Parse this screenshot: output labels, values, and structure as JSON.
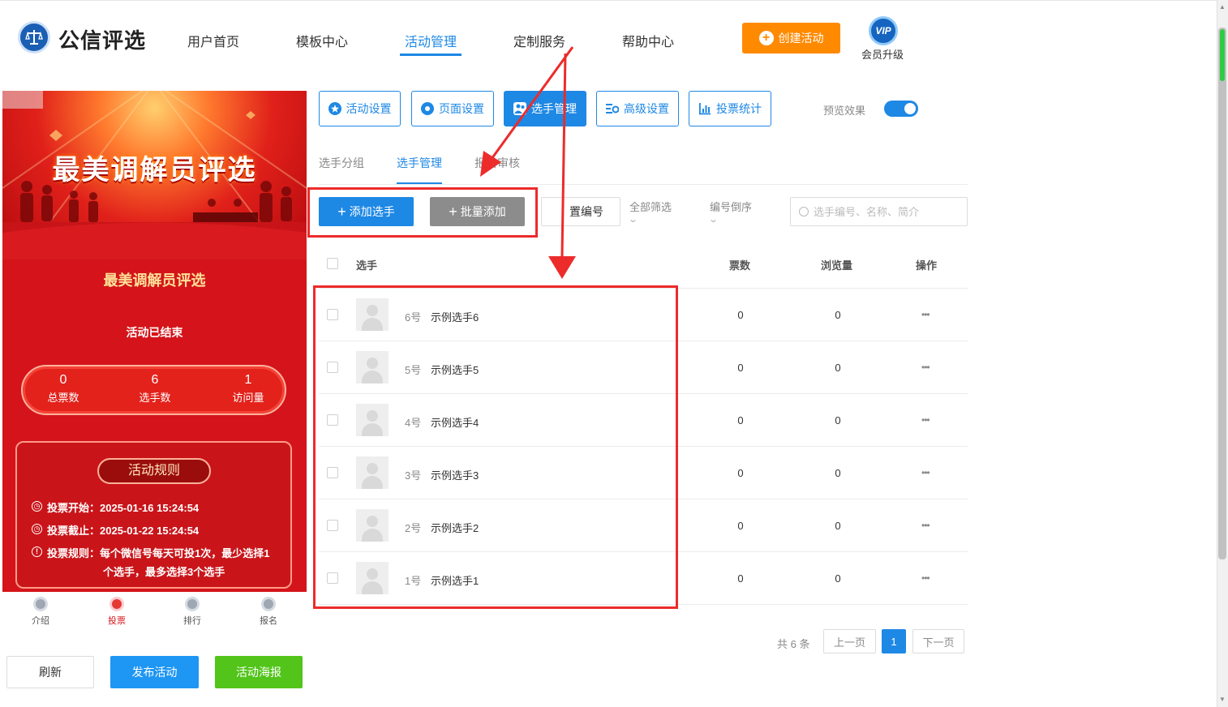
{
  "header": {
    "logo_text": "公信评选",
    "nav": [
      "用户首页",
      "模板中心",
      "活动管理",
      "定制服务",
      "帮助中心"
    ],
    "active_nav": "活动管理",
    "create_button": "创建活动",
    "vip_badge": "VIP",
    "vip_label": "会员升级"
  },
  "preview": {
    "banner_title": "最美调解员评选",
    "title": "最美调解员评选",
    "status": "活动已结束",
    "stats": [
      {
        "value": "0",
        "label": "总票数"
      },
      {
        "value": "6",
        "label": "选手数"
      },
      {
        "value": "1",
        "label": "访问量"
      }
    ],
    "rules_title": "活动规则",
    "rules": [
      {
        "icon": "clock-icon",
        "text": "投票开始：2025-01-16 15:24:54"
      },
      {
        "icon": "clock-icon",
        "text": "投票截止：2025-01-22 15:24:54"
      },
      {
        "icon": "info-icon",
        "text": "投票规则：每个微信号每天可投1次，最少选择1",
        "text2": "个选手，最多选择3个选手"
      }
    ],
    "tabs": [
      "介绍",
      "投票",
      "排行",
      "报名"
    ],
    "active_tab": "投票"
  },
  "bottom_buttons": {
    "refresh": "刷新",
    "publish": "发布活动",
    "poster": "活动海报"
  },
  "toolbar": {
    "buttons": [
      "活动设置",
      "页面设置",
      "选手管理",
      "高级设置",
      "投票统计"
    ],
    "active": "选手管理",
    "preview_label": "预览效果",
    "preview_on": true
  },
  "subtabs": [
    "选手分组",
    "选手管理",
    "报名审核"
  ],
  "active_subtab": "选手管理",
  "actions": {
    "add": "添加选手",
    "batch_add": "批量添加",
    "set_number": "置编号",
    "filter_all": "全部筛选",
    "sort": "编号倒序",
    "search_placeholder": "选手编号、名称、简介"
  },
  "table": {
    "headers": {
      "player": "选手",
      "votes": "票数",
      "views": "浏览量",
      "ops": "操作"
    },
    "rows": [
      {
        "num": "6号",
        "name": "示例选手6",
        "votes": "0",
        "views": "0"
      },
      {
        "num": "5号",
        "name": "示例选手5",
        "votes": "0",
        "views": "0"
      },
      {
        "num": "4号",
        "name": "示例选手4",
        "votes": "0",
        "views": "0"
      },
      {
        "num": "3号",
        "name": "示例选手3",
        "votes": "0",
        "views": "0"
      },
      {
        "num": "2号",
        "name": "示例选手2",
        "votes": "0",
        "views": "0"
      },
      {
        "num": "1号",
        "name": "示例选手1",
        "votes": "0",
        "views": "0"
      }
    ],
    "more_glyph": "•••"
  },
  "pagination": {
    "total": "共 6 条",
    "prev": "上一页",
    "current": "1",
    "next": "下一页"
  },
  "colors": {
    "primary": "#1e88e5",
    "orange": "#ff8a00",
    "green": "#52c41a",
    "annotation_red": "#ec2b2b",
    "poster_red": "#d4141a"
  }
}
